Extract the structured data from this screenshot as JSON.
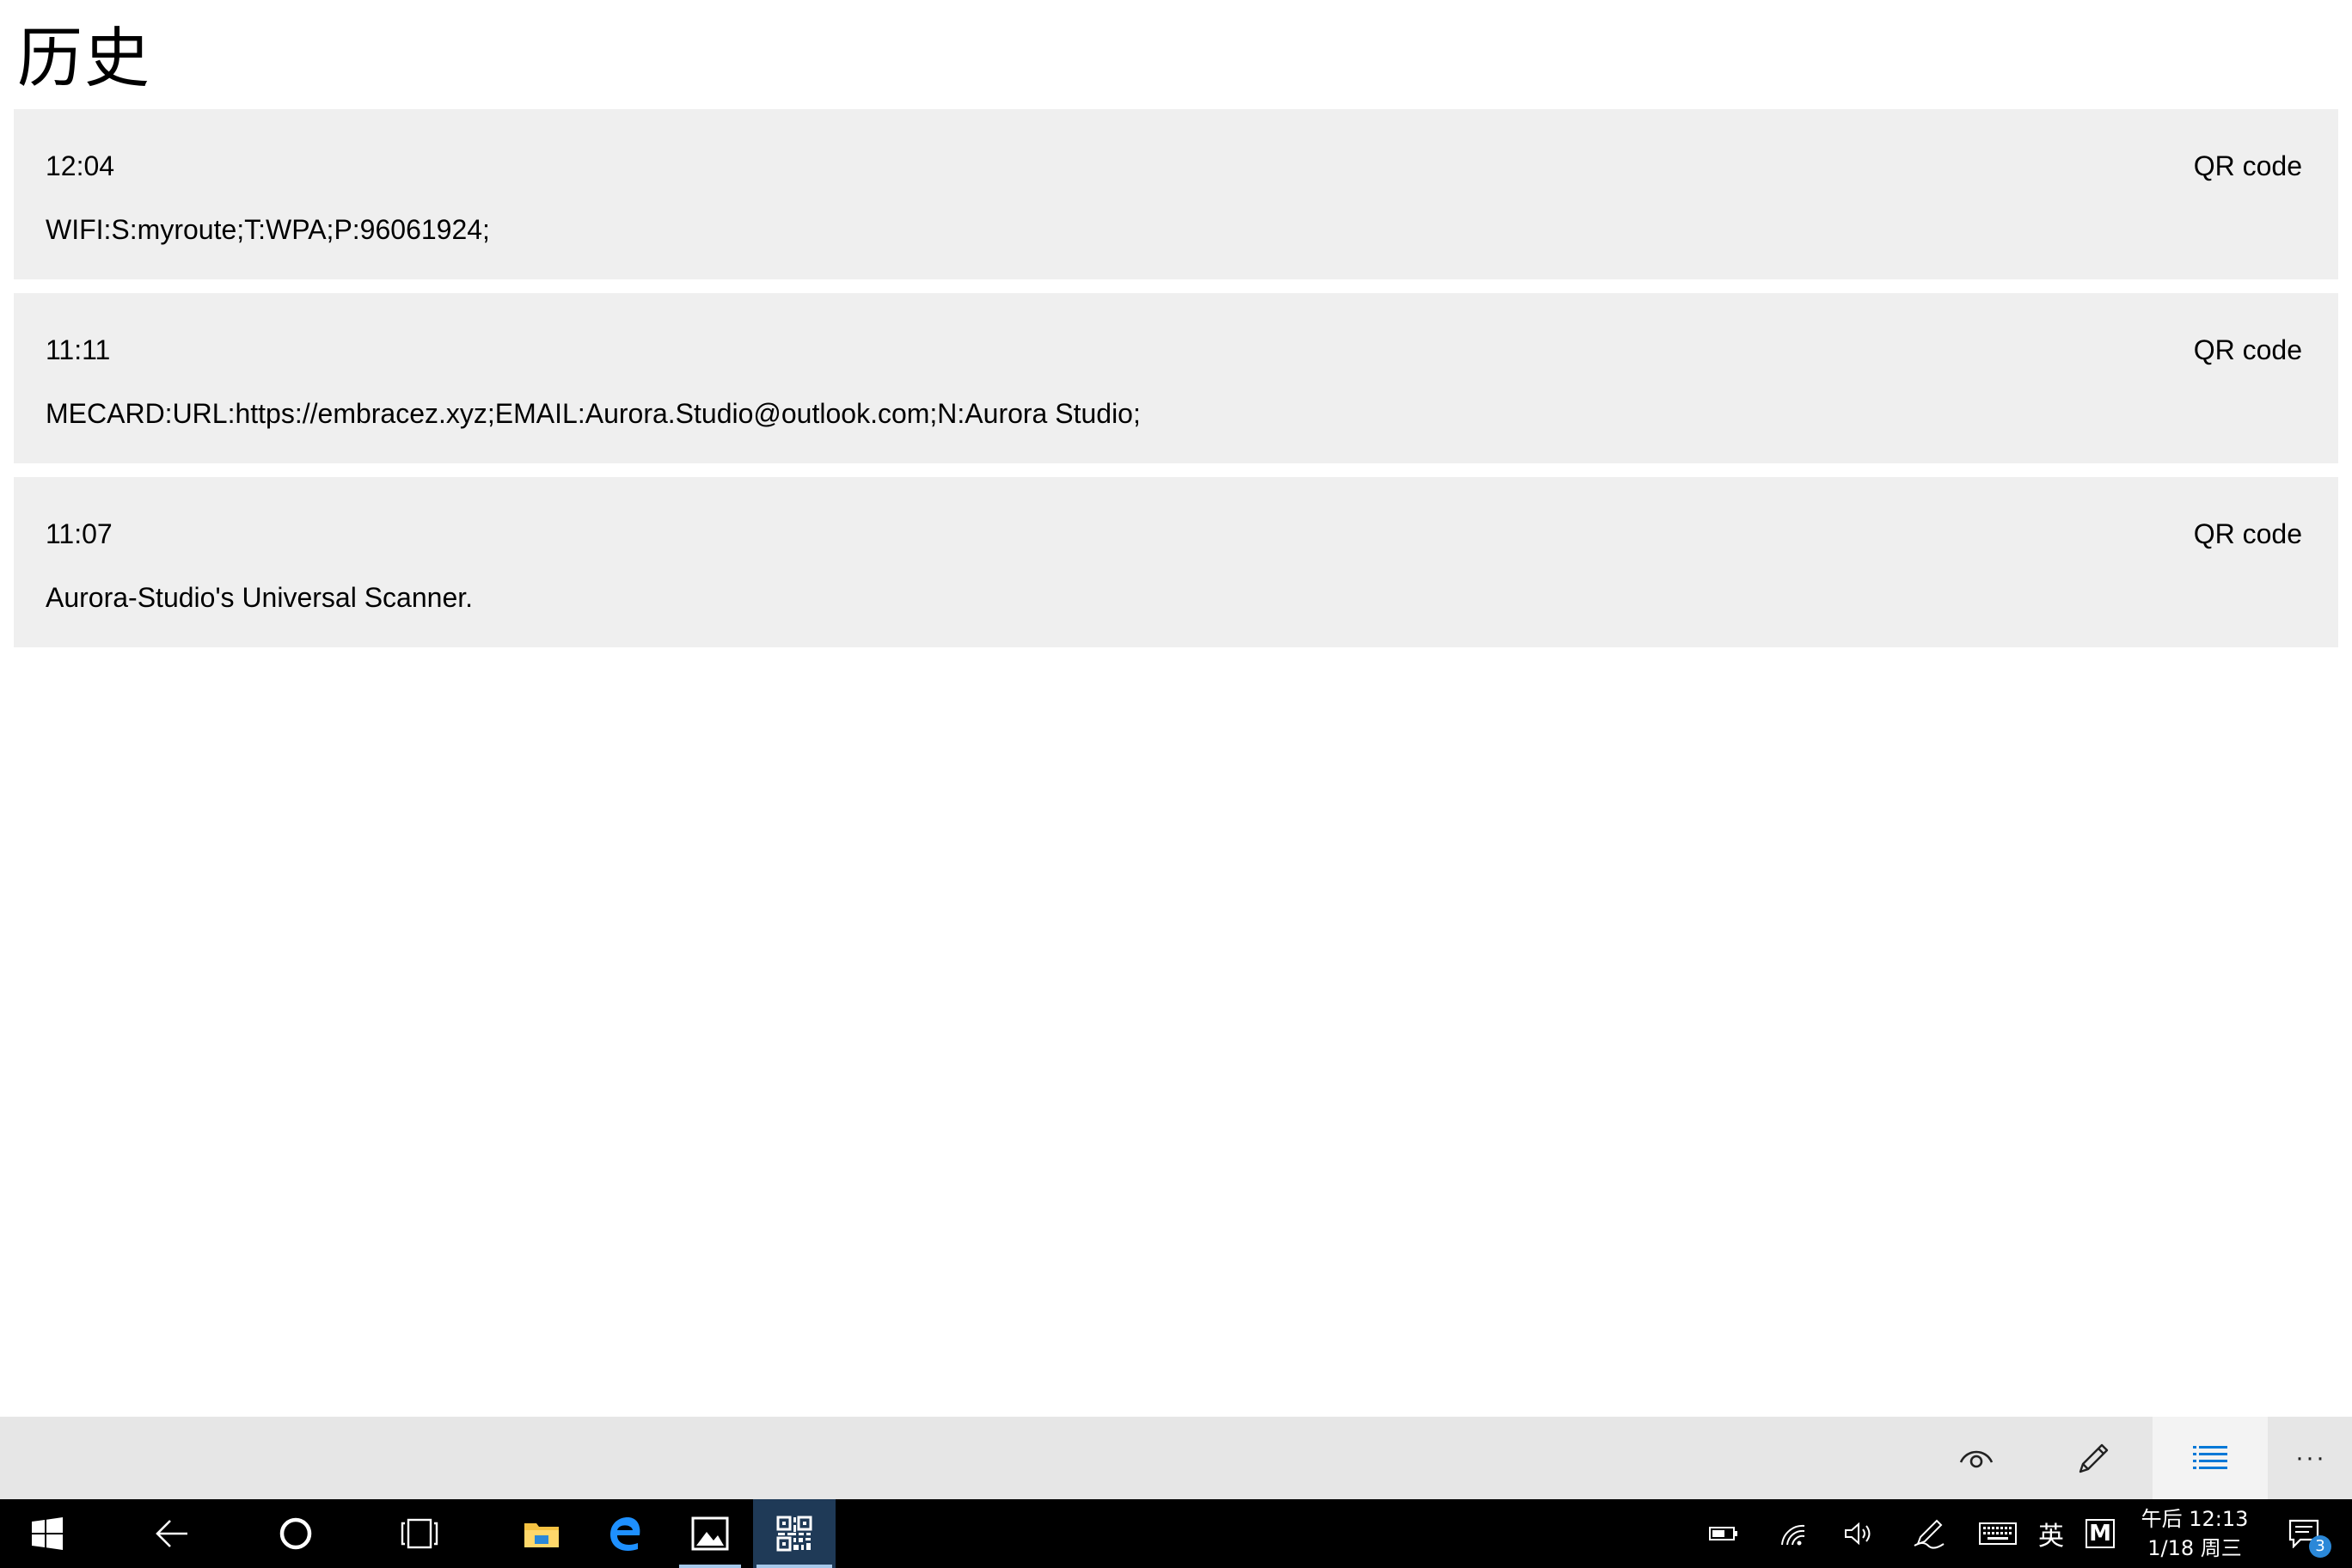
{
  "page": {
    "title": "历史"
  },
  "history": [
    {
      "time": "12:04",
      "type": "QR code",
      "content": "WIFI:S:myroute;T:WPA;P:96061924;"
    },
    {
      "time": "11:11",
      "type": "QR code",
      "content": "MECARD:URL:https://embracez.xyz;EMAIL:Aurora.Studio@outlook.com;N:Aurora Studio;"
    },
    {
      "time": "11:07",
      "type": "QR code",
      "content": "Aurora-Studio's Universal Scanner."
    }
  ],
  "command_bar": {
    "buttons": [
      {
        "icon": "eye-icon"
      },
      {
        "icon": "pencil-icon"
      },
      {
        "icon": "list-icon",
        "active": true
      },
      {
        "icon": "more-icon",
        "label": "···"
      }
    ],
    "accent_color": "#0078d7"
  },
  "taskbar": {
    "apps": [
      {
        "icon": "windows-start-icon"
      },
      {
        "icon": "back-arrow-icon"
      },
      {
        "icon": "cortana-circle-icon"
      },
      {
        "icon": "task-view-icon"
      },
      {
        "icon": "file-explorer-icon"
      },
      {
        "icon": "edge-icon"
      },
      {
        "icon": "photos-icon",
        "running": true
      },
      {
        "icon": "qr-scanner-icon",
        "running": true,
        "focused": true
      }
    ],
    "tray": {
      "ime_label": "英",
      "ime_mode": "M",
      "time": "午后 12:13",
      "date": "1/18 周三",
      "notification_count": "3"
    }
  }
}
